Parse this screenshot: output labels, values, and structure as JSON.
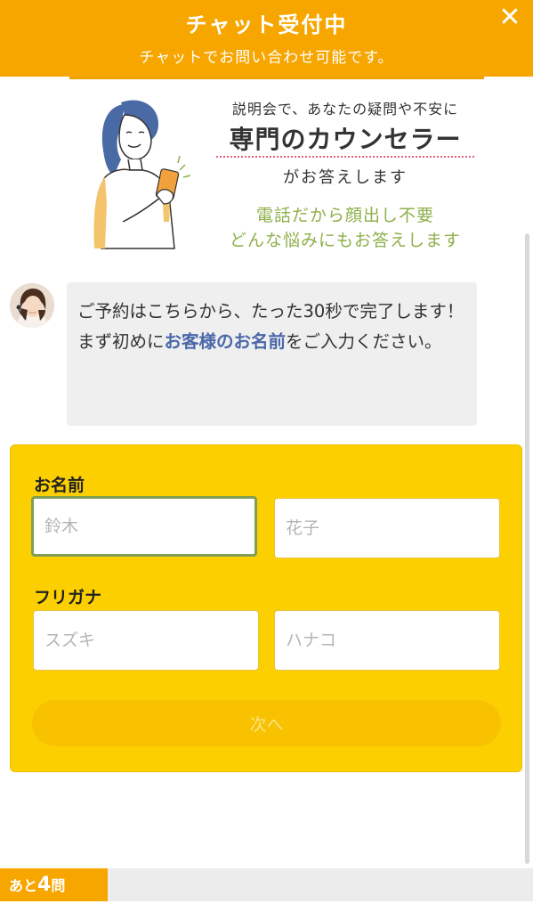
{
  "header": {
    "title": "チャット受付中",
    "subtitle": "チャットでお問い合わせ可能です。",
    "close_label": "✕"
  },
  "banner": {
    "line1": "説明会で、あなたの疑問や不安に",
    "line2": "専門のカウンセラー",
    "line3": "がお答えします",
    "line4": "電話だから顔出し不要",
    "line5": "どんな悩みにもお答えします"
  },
  "chat": {
    "message_part1": "ご予約はこちらから、たった30秒で完了します！",
    "message_part2": "まず初めに",
    "message_highlight": "お客様のお名前",
    "message_part3": "をご入力ください。"
  },
  "form": {
    "name_label": "お名前",
    "last_name_placeholder": "鈴木",
    "first_name_placeholder": "花子",
    "furigana_label": "フリガナ",
    "last_kana_placeholder": "スズキ",
    "first_kana_placeholder": "ハナコ",
    "next_button": "次へ"
  },
  "footer": {
    "remaining_prefix": "あと",
    "remaining_count": "4",
    "remaining_suffix": "問"
  },
  "colors": {
    "header_orange": "#f7a600",
    "form_yellow": "#fcd000",
    "highlight_blue": "#4a67a8",
    "green_text": "#8db04a"
  }
}
